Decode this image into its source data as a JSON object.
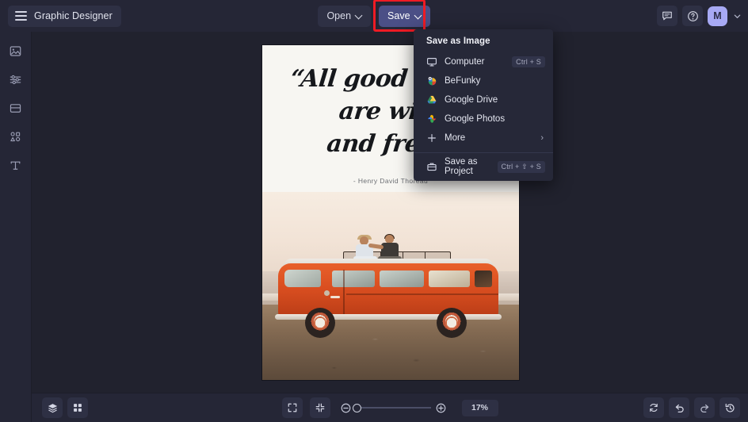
{
  "app": {
    "title": "Graphic Designer",
    "menu_icon": "hamburger-icon"
  },
  "topbar": {
    "open_label": "Open",
    "save_label": "Save",
    "feedback_icon": "comment-icon",
    "help_icon": "help-circle-icon",
    "avatar_initial": "M",
    "avatar_caret_icon": "chevron-down-icon",
    "save_highlight_color": "#ef1b24",
    "save_button_color": "#4b4f86"
  },
  "sidebar": {
    "items": [
      {
        "name": "image",
        "icon": "image-icon"
      },
      {
        "name": "edit",
        "icon": "sliders-icon"
      },
      {
        "name": "frames",
        "icon": "frame-icon"
      },
      {
        "name": "graphics",
        "icon": "shapes-icon"
      },
      {
        "name": "text",
        "icon": "text-icon"
      }
    ]
  },
  "save_menu": {
    "title": "Save as Image",
    "items": [
      {
        "label": "Computer",
        "icon": "computer-icon",
        "shortcut": "Ctrl + S"
      },
      {
        "label": "BeFunky",
        "icon": "befunky-icon",
        "shortcut": ""
      },
      {
        "label": "Google Drive",
        "icon": "google-drive-icon",
        "shortcut": ""
      },
      {
        "label": "Google Photos",
        "icon": "google-photos-icon",
        "shortcut": ""
      },
      {
        "label": "More",
        "icon": "plus-icon",
        "shortcut": "",
        "arrow": "›"
      }
    ],
    "footer": {
      "label": "Save as Project",
      "icon": "briefcase-icon",
      "shortcut": "Ctrl + ⇧ + S"
    }
  },
  "canvas": {
    "quote_line1": "“All good things",
    "quote_line2": "are wild",
    "quote_line3": "and free”",
    "attribution": "- Henry David Thoreau",
    "photo_description": "Two people sitting on the roof rack of an orange vintage VW bus parked on a beach at sunset"
  },
  "bottombar": {
    "layers_icon": "layers-icon",
    "grid_icon": "grid-icon",
    "fit_icon": "fit-screen-icon",
    "shrink_icon": "shrink-icon",
    "zoom_out_icon": "zoom-out-icon",
    "zoom_in_icon": "zoom-in-icon",
    "zoom_value": "17%",
    "reset_icon": "reset-icon",
    "undo_icon": "undo-icon",
    "redo_icon": "redo-icon",
    "history_icon": "history-icon"
  }
}
